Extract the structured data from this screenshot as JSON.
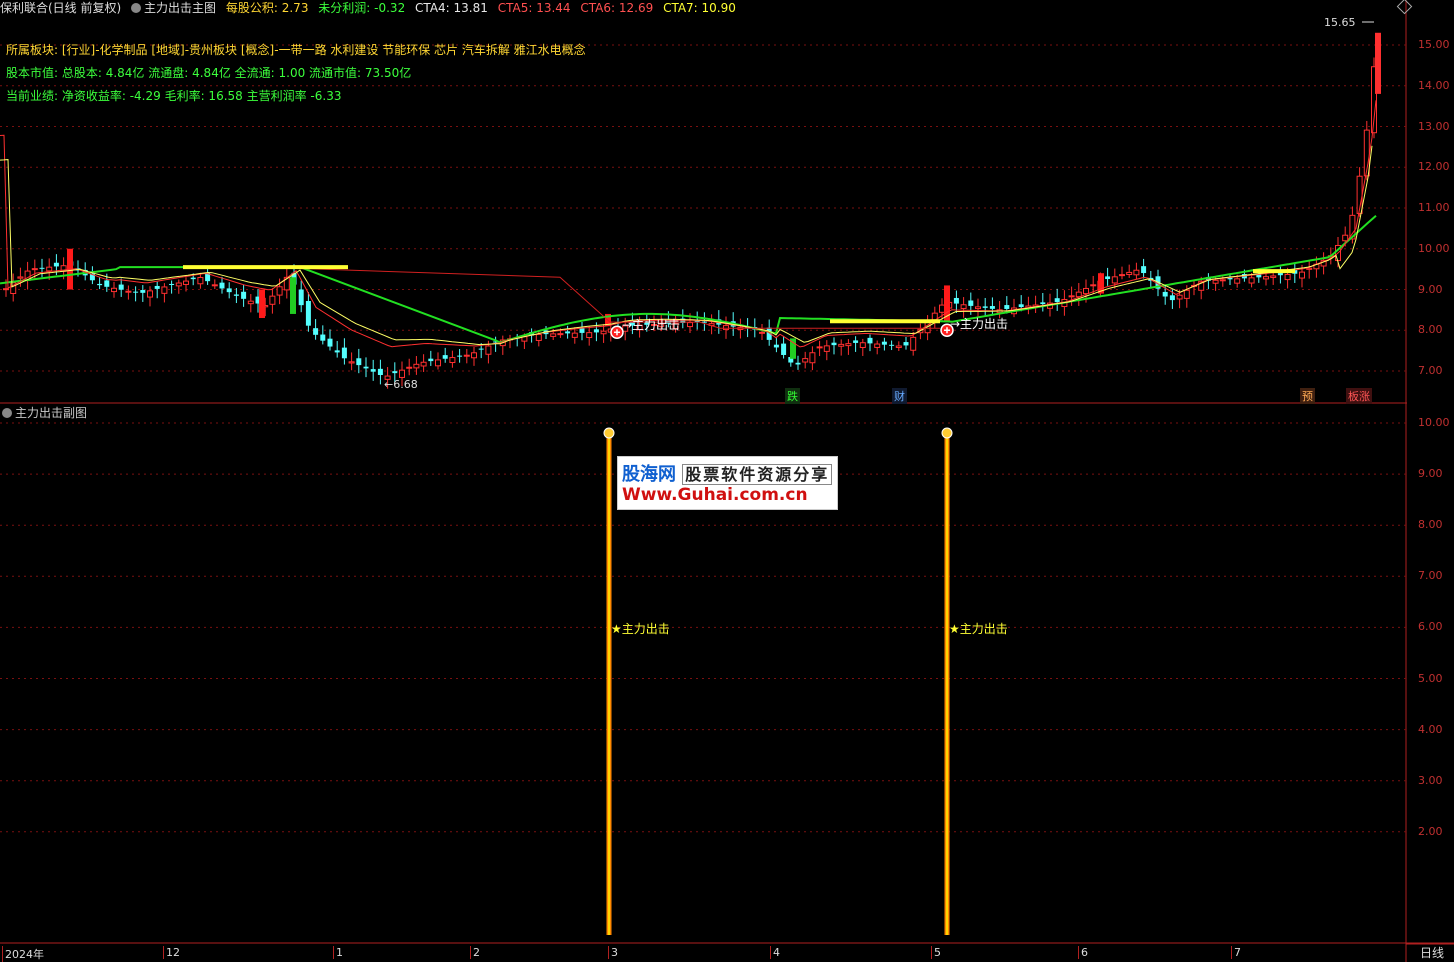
{
  "header": {
    "stock_title": "保利联合(日线 前复权)",
    "indicator_name": "主力出击主图",
    "eps_label": "每股公积:",
    "eps_value": "2.73",
    "undistributed_label": "未分利润:",
    "undistributed_value": "-0.32",
    "cta4": "CTA4: 13.81",
    "cta5": "CTA5: 13.44",
    "cta6": "CTA6: 12.69",
    "cta7": "CTA7: 10.90"
  },
  "info": {
    "sector": "所属板块: [行业]-化学制品 [地域]-贵州板块 [概念]-一带一路 水利建设 节能环保 芯片 汽车拆解 雅江水电概念",
    "capital": "股本市值: 总股本: 4.84亿 流通盘: 4.84亿 全流通: 1.00 流通市值: 73.50亿",
    "performance": "当前业绩: 净资收益率: -4.29 毛利率: 16.58 主营利润率 -6.33"
  },
  "main_axis": [
    "15.00",
    "14.00",
    "13.00",
    "12.00",
    "11.00",
    "10.00",
    "9.00",
    "8.00",
    "7.00"
  ],
  "sub_axis": [
    "10.00",
    "9.00",
    "8.00",
    "7.00",
    "6.00",
    "5.00",
    "4.00",
    "3.00",
    "2.00"
  ],
  "x_axis": [
    "2024年",
    "12",
    "1",
    "2",
    "3",
    "4",
    "5",
    "6",
    "7"
  ],
  "annotations": {
    "high": "15.65",
    "low": "←6.68",
    "signal": "主力出击",
    "signal_arrow": "→主力出击",
    "mark_die": "跌",
    "mark_cai": "财",
    "mark_yu": "预",
    "mark_zhang": "板涨"
  },
  "sub_panel": {
    "title": "主力出击副图",
    "signal_label": "★主力出击"
  },
  "watermark": {
    "brand": "股海网",
    "slogan": "股票软件资源分享",
    "url": "Www.Guhai.com.cn"
  },
  "period": "日线",
  "colors": {
    "up": "#ff3030",
    "down": "#54ffff",
    "ma_green": "#22e022",
    "ma_yellow": "#ffff33",
    "grid": "#7a1010"
  }
}
